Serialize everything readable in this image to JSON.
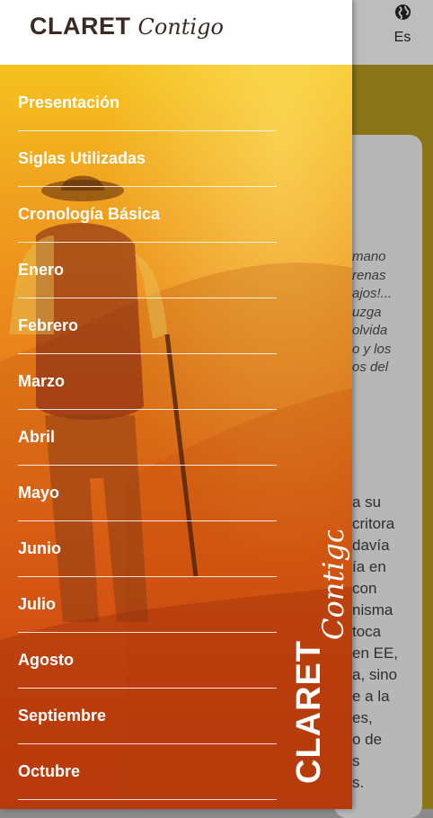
{
  "app": {
    "brand": "CLARET",
    "brand_script": "Contigo",
    "language": "Es"
  },
  "menu": [
    {
      "label": "Presentación"
    },
    {
      "label": "Siglas Utilizadas"
    },
    {
      "label": "Cronología Básica"
    },
    {
      "label": "Enero"
    },
    {
      "label": "Febrero"
    },
    {
      "label": "Marzo"
    },
    {
      "label": "Abril"
    },
    {
      "label": "Mayo"
    },
    {
      "label": "Junio"
    },
    {
      "label": "Julio"
    },
    {
      "label": "Agosto"
    },
    {
      "label": "Septiembre"
    },
    {
      "label": "Octubre"
    }
  ],
  "background_text": {
    "italic_lines": [
      "mano",
      "renas",
      "ajos!...",
      "uzga",
      "olvida",
      "o y los",
      "os del"
    ],
    "body_lines": [
      "a su",
      "critora",
      "davía",
      "ía en",
      "con",
      "nisma",
      "toca",
      "en EE,",
      "a, sino",
      "e a la",
      "es,",
      "o de",
      "s",
      "s."
    ]
  },
  "colors": {
    "drawer_top": "#f5c21f",
    "drawer_bottom": "#d33f10",
    "logo_text": "#3b2a24",
    "olive_band": "#8a7618"
  },
  "icons": {
    "language": "globe-icon"
  }
}
